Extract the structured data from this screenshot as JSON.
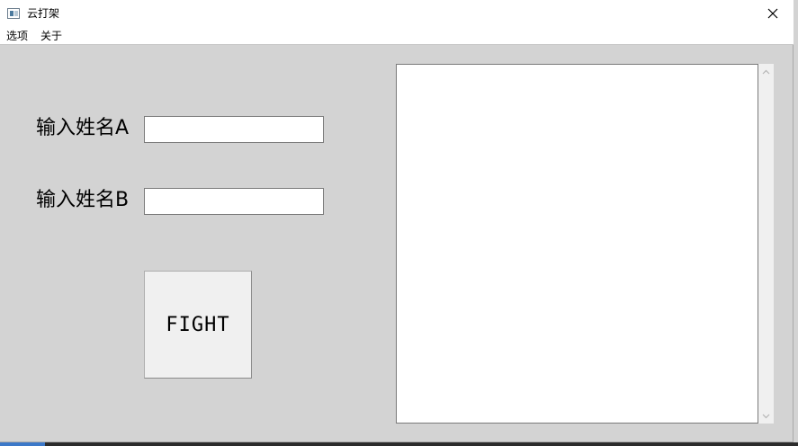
{
  "window": {
    "title": "云打架"
  },
  "menu": {
    "items": [
      "选项",
      "关于"
    ]
  },
  "form": {
    "label_a": "输入姓名A",
    "label_b": "输入姓名B",
    "input_a_value": "",
    "input_b_value": "",
    "fight_label": "FIGHT"
  },
  "output": {
    "text": ""
  },
  "icons": {
    "app": "app-window-icon",
    "close": "close-icon",
    "scroll_up": "chevron-up-icon",
    "scroll_down": "chevron-down-icon"
  },
  "colors": {
    "background": "#d3d3d3",
    "titlebar": "#ffffff",
    "button_face": "#f0f0f0"
  }
}
